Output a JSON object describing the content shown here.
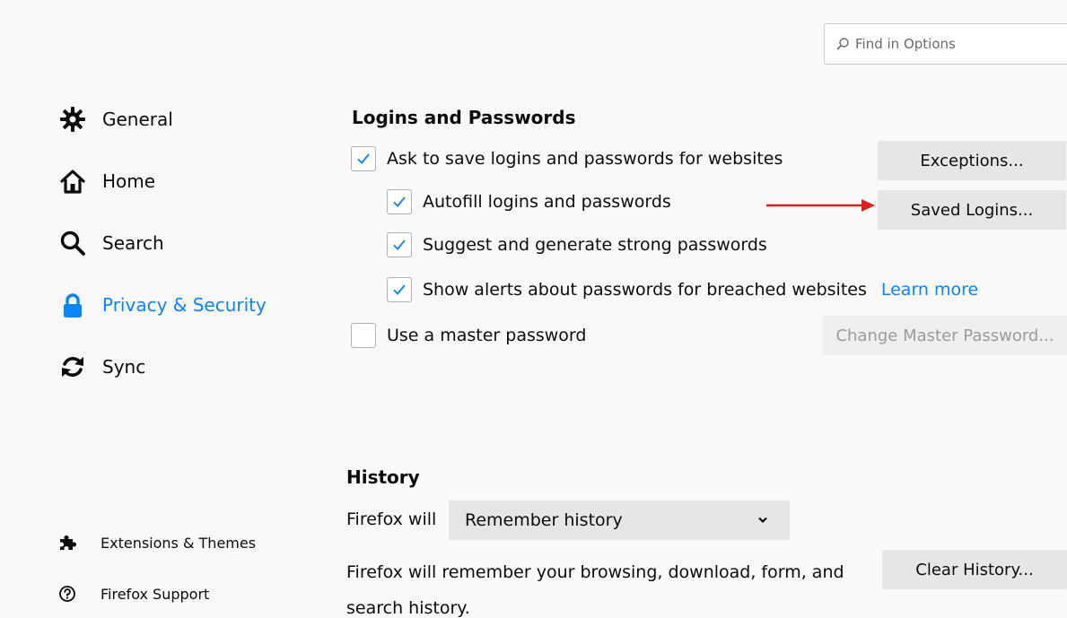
{
  "search": {
    "placeholder": "Find in Options",
    "icon": "search-icon"
  },
  "sidebar": {
    "items": [
      {
        "label": "General",
        "icon": "gear-icon"
      },
      {
        "label": "Home",
        "icon": "home-icon"
      },
      {
        "label": "Search",
        "icon": "search-icon"
      },
      {
        "label": "Privacy & Security",
        "icon": "lock-icon",
        "active": true
      },
      {
        "label": "Sync",
        "icon": "sync-icon"
      }
    ],
    "footer": [
      {
        "label": "Extensions & Themes",
        "icon": "puzzle-icon"
      },
      {
        "label": "Firefox Support",
        "icon": "help-icon"
      }
    ]
  },
  "logins": {
    "title": "Logins and Passwords",
    "options": [
      {
        "label": "Ask to save logins and passwords for websites",
        "checked": true
      },
      {
        "label": "Autofill logins and passwords",
        "checked": true
      },
      {
        "label": "Suggest and generate strong passwords",
        "checked": true
      },
      {
        "label": "Show alerts about passwords for breached websites",
        "checked": true
      },
      {
        "label": "Use a master password",
        "checked": false
      }
    ],
    "learn_more": "Learn more",
    "exceptions_button": "Exceptions...",
    "saved_logins_button": "Saved Logins...",
    "change_master_button": "Change Master Password..."
  },
  "history": {
    "title": "History",
    "firefox_will_label": "Firefox will",
    "mode_selected": "Remember history",
    "description": "Firefox will remember your browsing, download, form, and search history.",
    "clear_button": "Clear History..."
  },
  "colors": {
    "accent": "#0a84ff",
    "arrow": "#e02020",
    "check": "#0a84ff"
  }
}
